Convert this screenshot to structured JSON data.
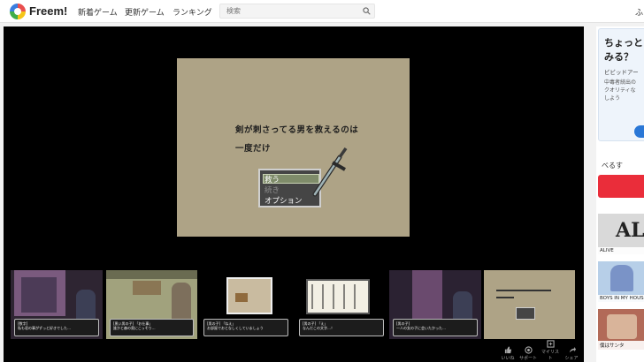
{
  "header": {
    "brand": "Freem!",
    "nav": [
      "新着ゲーム",
      "更新ゲーム",
      "ランキング"
    ],
    "search_placeholder": "検索",
    "cut_text": "ふ"
  },
  "game": {
    "line1": "剣が刺さってる男を救えるのは",
    "line2": "一度だけ",
    "menu": [
      {
        "label": "救う",
        "selected": true
      },
      {
        "label": "続き",
        "selected": false
      },
      {
        "label": "オプション",
        "selected": false
      }
    ]
  },
  "thumbnails": [
    {
      "cap1": "[数字]",
      "cap2": "私も君の事がずっと好きでした…"
    },
    {
      "cap1": "[黒い男の子] 「お仕事」",
      "cap2": "誰かと森の奥にこっそり…"
    },
    {
      "cap1": "[男の子] 「ねえ」",
      "cap2": "お部屋でおとなしくしていましょう"
    },
    {
      "cap1": "[男の子] 「え」",
      "cap2": "なんだこの文字…！"
    },
    {
      "cap1": "[男の子]",
      "cap2": "一人の女の子に会いたかった…"
    }
  ],
  "controls": [
    {
      "label": "いいね",
      "icon": "thumbs-up-icon"
    },
    {
      "label": "サポート",
      "icon": "support-icon"
    },
    {
      "label": "マイリスト",
      "icon": "mylist-icon"
    },
    {
      "label": "シェア",
      "icon": "share-icon"
    }
  ],
  "sidebar": {
    "ad_title_1": "ちょっと",
    "ad_title_2": "みる？",
    "ad_sub": "ビビッドアー",
    "ad_text": [
      "中毒者続出の",
      "クオリティな",
      "しよう"
    ],
    "section_label": "べるす",
    "recommended": [
      {
        "title": "ALIVE"
      },
      {
        "title": "BOYS IN MY HOUSE"
      },
      {
        "title": "僕はサンタ"
      }
    ]
  },
  "colors": {
    "screen_bg": "#aea386",
    "menu_bg": "#454545",
    "menu_selected": "#7f8c6a",
    "sidebar_red": "#ea2d3a",
    "ad_button": "#2a77d6"
  }
}
